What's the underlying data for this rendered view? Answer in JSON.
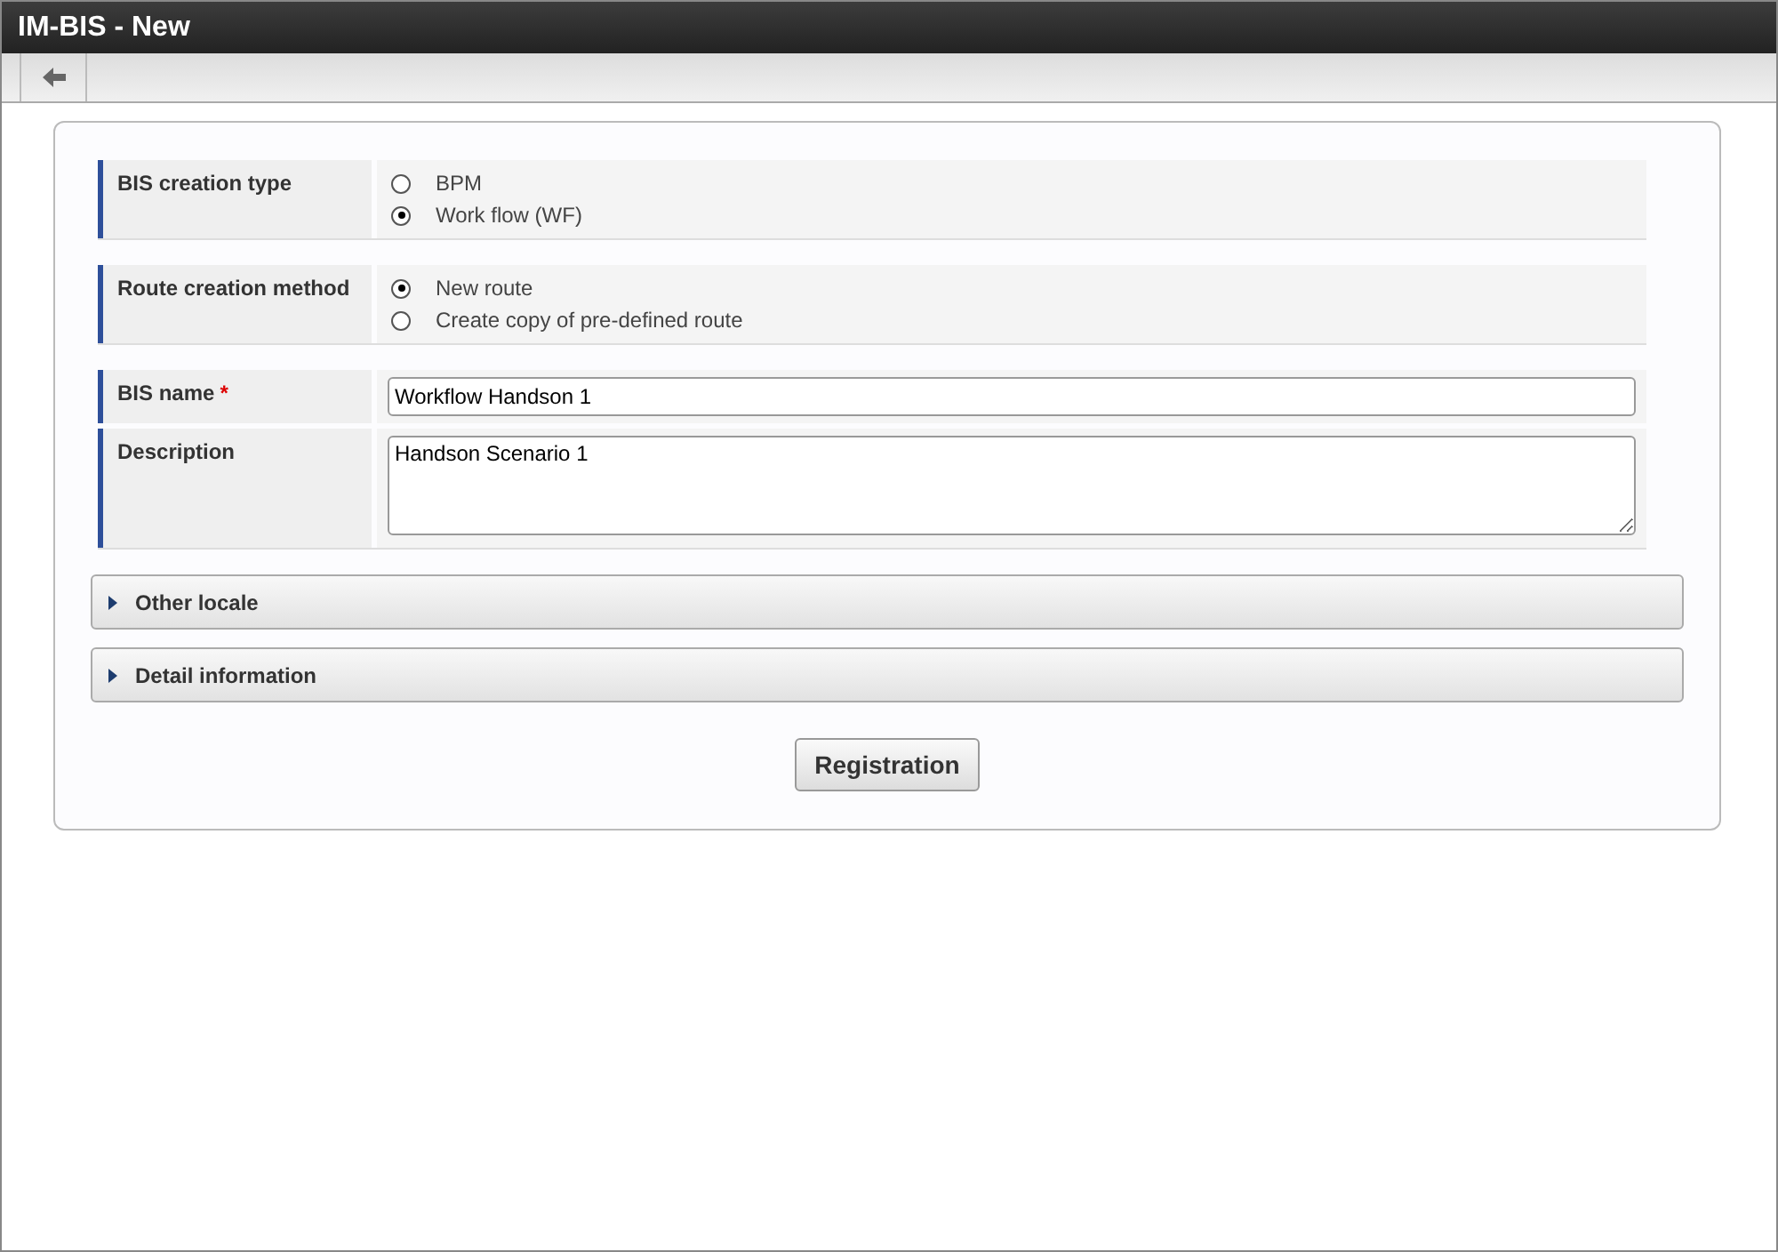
{
  "window": {
    "title": "IM-BIS - New"
  },
  "form": {
    "groups": [
      {
        "rows": [
          {
            "kind": "radio",
            "label": "BIS creation type",
            "options": [
              {
                "label": "BPM",
                "selected": false
              },
              {
                "label": "Work flow (WF)",
                "selected": true
              }
            ]
          }
        ]
      },
      {
        "rows": [
          {
            "kind": "radio",
            "label": "Route creation method",
            "options": [
              {
                "label": "New route",
                "selected": true
              },
              {
                "label": "Create copy of pre-defined route",
                "selected": false
              }
            ]
          }
        ]
      },
      {
        "rows": [
          {
            "kind": "text",
            "label": "BIS name",
            "required_mark": "*",
            "value": "Workflow Handson 1"
          },
          {
            "kind": "textarea",
            "label": "Description",
            "value": "Handson Scenario 1"
          }
        ]
      }
    ]
  },
  "sections": [
    {
      "label": "Other locale",
      "expanded": false
    },
    {
      "label": "Detail information",
      "expanded": false
    }
  ],
  "buttons": [
    {
      "label": "Registration"
    }
  ]
}
